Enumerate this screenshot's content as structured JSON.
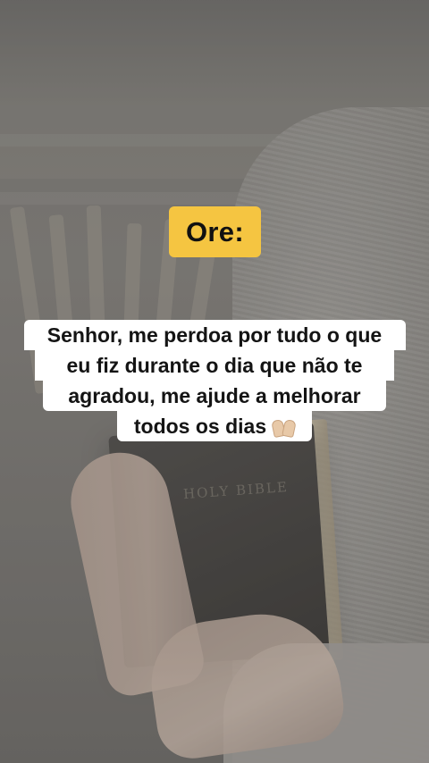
{
  "story": {
    "label": "Ore:",
    "prayer_lines": [
      "Senhor, me perdoa por tudo o que",
      "eu fiz durante o dia que não te",
      "agradou, me ajude a melhorar",
      "todos os dias"
    ],
    "emoji_icon": "raising-hands-icon"
  },
  "background": {
    "book_spine_text": "HOLY BIBLE"
  },
  "colors": {
    "label_background": "#f5c541",
    "label_text": "#111111",
    "prayer_background": "#ffffff",
    "prayer_text": "#141414"
  }
}
